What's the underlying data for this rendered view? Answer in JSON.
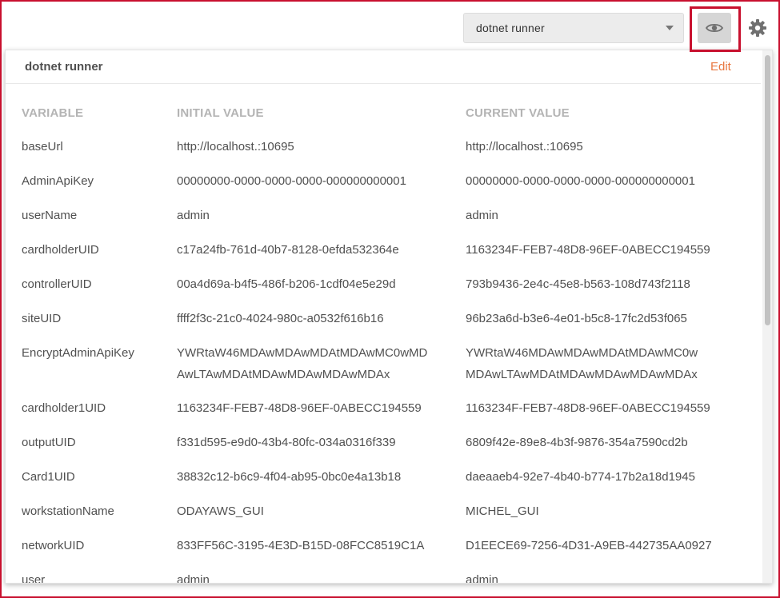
{
  "topbar": {
    "environment_label": "dotnet runner"
  },
  "panel": {
    "title": "dotnet runner",
    "edit_label": "Edit",
    "columns": {
      "variable": "VARIABLE",
      "initial": "INITIAL VALUE",
      "current": "CURRENT VALUE"
    },
    "rows": [
      {
        "variable": "baseUrl",
        "initial": [
          "http://localhost.:10695"
        ],
        "current": [
          "http://localhost.:10695"
        ]
      },
      {
        "variable": "AdminApiKey",
        "initial": [
          "00000000-0000-0000-0000-000000000001"
        ],
        "current": [
          "00000000-0000-0000-0000-000000000001"
        ]
      },
      {
        "variable": "userName",
        "initial": [
          "admin"
        ],
        "current": [
          "admin"
        ]
      },
      {
        "variable": "cardholderUID",
        "initial": [
          "c17a24fb-761d-40b7-8128-0efda532364e"
        ],
        "current": [
          "1163234F-FEB7-48D8-96EF-0ABECC194559"
        ]
      },
      {
        "variable": "controllerUID",
        "initial": [
          "00a4d69a-b4f5-486f-b206-1cdf04e5e29d"
        ],
        "current": [
          "793b9436-2e4c-45e8-b563-108d743f2118"
        ]
      },
      {
        "variable": "siteUID",
        "initial": [
          "ffff2f3c-21c0-4024-980c-a0532f616b16"
        ],
        "current": [
          "96b23a6d-b3e6-4e01-b5c8-17fc2d53f065"
        ]
      },
      {
        "variable": "EncryptAdminApiKey",
        "initial": [
          "YWRtaW46MDAwMDAwMDAtMDAwMC0wMD",
          "AwLTAwMDAtMDAwMDAwMDAwMDAx"
        ],
        "current": [
          "YWRtaW46MDAwMDAwMDAtMDAwMC0w",
          "MDAwLTAwMDAtMDAwMDAwMDAwMDAx"
        ]
      },
      {
        "variable": "cardholder1UID",
        "initial": [
          "1163234F-FEB7-48D8-96EF-0ABECC194559"
        ],
        "current": [
          "1163234F-FEB7-48D8-96EF-0ABECC194559"
        ]
      },
      {
        "variable": "outputUID",
        "initial": [
          "f331d595-e9d0-43b4-80fc-034a0316f339"
        ],
        "current": [
          "6809f42e-89e8-4b3f-9876-354a7590cd2b"
        ]
      },
      {
        "variable": "Card1UID",
        "initial": [
          "38832c12-b6c9-4f04-ab95-0bc0e4a13b18"
        ],
        "current": [
          "daeaaeb4-92e7-4b40-b774-17b2a18d1945"
        ]
      },
      {
        "variable": "workstationName",
        "initial": [
          "ODAYAWS_GUI"
        ],
        "current": [
          "MICHEL_GUI"
        ]
      },
      {
        "variable": "networkUID",
        "initial": [
          "833FF56C-3195-4E3D-B15D-08FCC8519C1A"
        ],
        "current": [
          "D1EECE69-7256-4D31-A9EB-442735AA0927"
        ]
      },
      {
        "variable": "user",
        "initial": [
          "admin"
        ],
        "current": [
          "admin"
        ]
      }
    ]
  },
  "colors": {
    "accent_edit": "#e8773f",
    "highlight_frame": "#c8102e",
    "header_text": "#b4b4b4"
  },
  "icons": {
    "eye": "eye-icon",
    "gear": "gear-icon",
    "dropdown": "chevron-down-icon"
  }
}
